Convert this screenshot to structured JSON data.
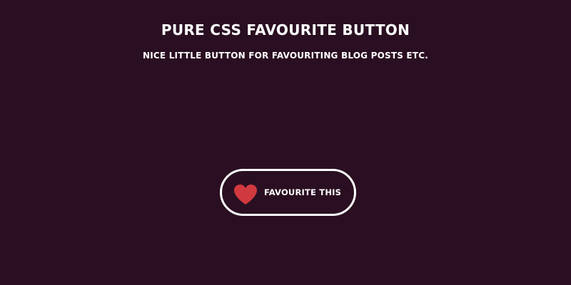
{
  "header": {
    "title": "PURE CSS FAVOURITE BUTTON",
    "subtitle": "NICE LITTLE BUTTON FOR FAVOURITING BLOG POSTS ETC."
  },
  "favourite_button": {
    "label": "FAVOURITE THIS",
    "icon": "heart-icon",
    "favourited": false
  },
  "colors": {
    "background": "#2a0f22",
    "text": "#ffffff",
    "button_border": "#ffffff",
    "heart": "#d0393e"
  }
}
